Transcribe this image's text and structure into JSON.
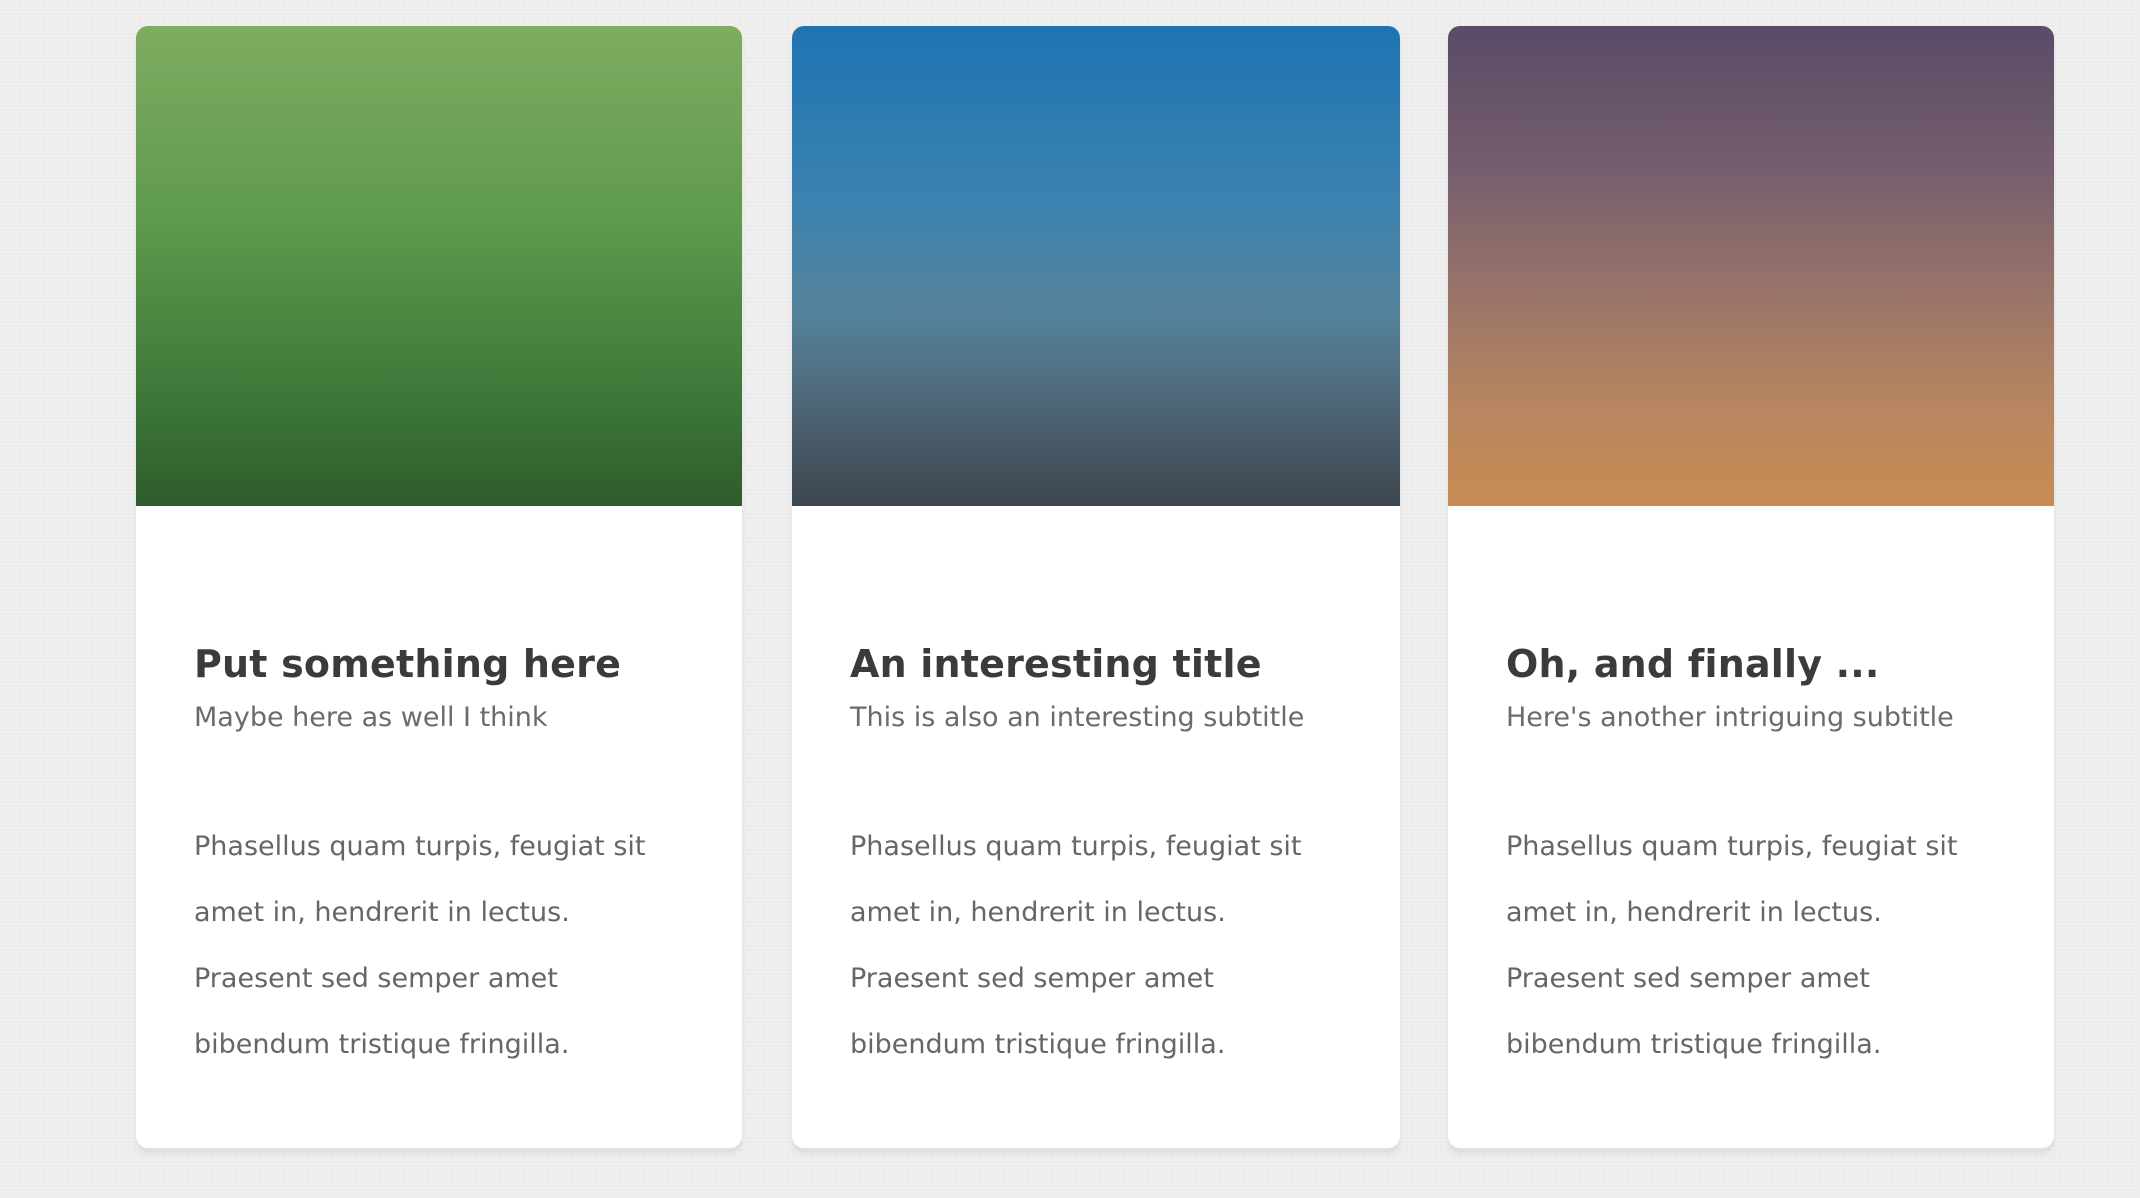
{
  "cards": [
    {
      "title": "Put something here",
      "subtitle": "Maybe here as well I think",
      "text": "Phasellus quam turpis, feugiat sit amet in, hendrerit in lectus. Praesent sed semper amet bibendum tristique fringilla.",
      "image_colors": [
        "#7fac61",
        "#2e5c2c"
      ]
    },
    {
      "title": "An interesting title",
      "subtitle": "This is also an interesting subtitle",
      "text": "Phasellus quam turpis, feugiat sit amet in, hendrerit in lectus. Praesent sed semper amet bibendum tristique fringilla.",
      "image_colors": [
        "#1e74b2",
        "#3d464f"
      ]
    },
    {
      "title": "Oh, and finally ...",
      "subtitle": "Here's another intriguing subtitle",
      "text": "Phasellus quam turpis, feugiat sit amet in, hendrerit in lectus. Praesent sed semper amet bibendum tristique fringilla.",
      "image_colors": [
        "#5a4b67",
        "#c78c53"
      ]
    }
  ]
}
